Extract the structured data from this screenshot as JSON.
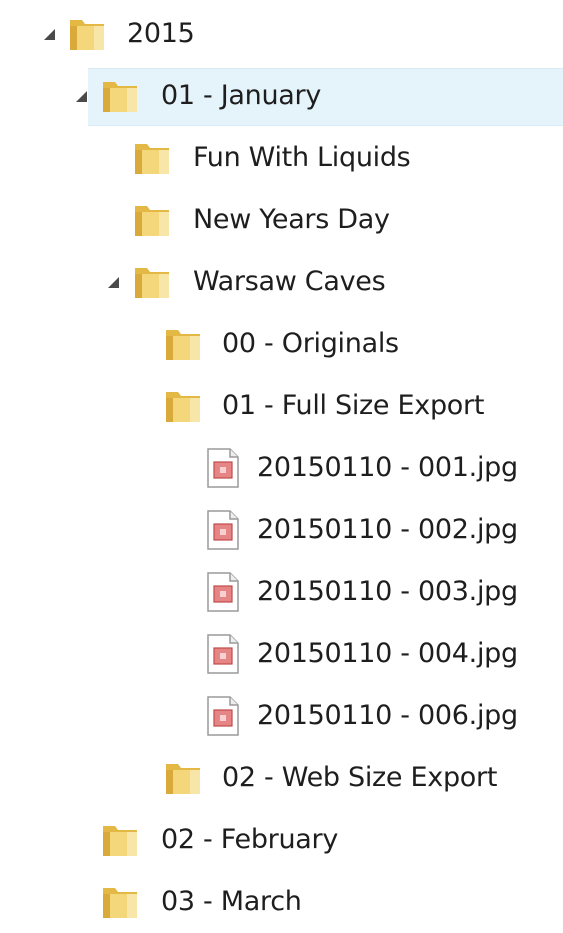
{
  "tree": {
    "rows": [
      {
        "label": "2015",
        "icon": "folder-icon",
        "expanded": true
      },
      {
        "label": "01 - January",
        "icon": "folder-icon",
        "expanded": true,
        "selected": true
      },
      {
        "label": "Fun With Liquids",
        "icon": "folder-icon"
      },
      {
        "label": "New Years Day",
        "icon": "folder-icon"
      },
      {
        "label": "Warsaw Caves",
        "icon": "folder-icon",
        "expanded": true
      },
      {
        "label": "00 - Originals",
        "icon": "folder-icon"
      },
      {
        "label": "01 - Full Size Export",
        "icon": "folder-icon"
      },
      {
        "label": "20150110 - 001.jpg",
        "icon": "image-file-icon"
      },
      {
        "label": "20150110 - 002.jpg",
        "icon": "image-file-icon"
      },
      {
        "label": "20150110 - 003.jpg",
        "icon": "image-file-icon"
      },
      {
        "label": "20150110 - 004.jpg",
        "icon": "image-file-icon"
      },
      {
        "label": "20150110 - 006.jpg",
        "icon": "image-file-icon"
      },
      {
        "label": "02 - Web Size Export",
        "icon": "folder-icon"
      },
      {
        "label": "02 - February",
        "icon": "folder-icon"
      },
      {
        "label": "03 - March",
        "icon": "folder-icon"
      }
    ]
  },
  "colors": {
    "selection": "#e5f3fb",
    "folder": "#e8c35b",
    "image_file_accent": "#d05050"
  }
}
